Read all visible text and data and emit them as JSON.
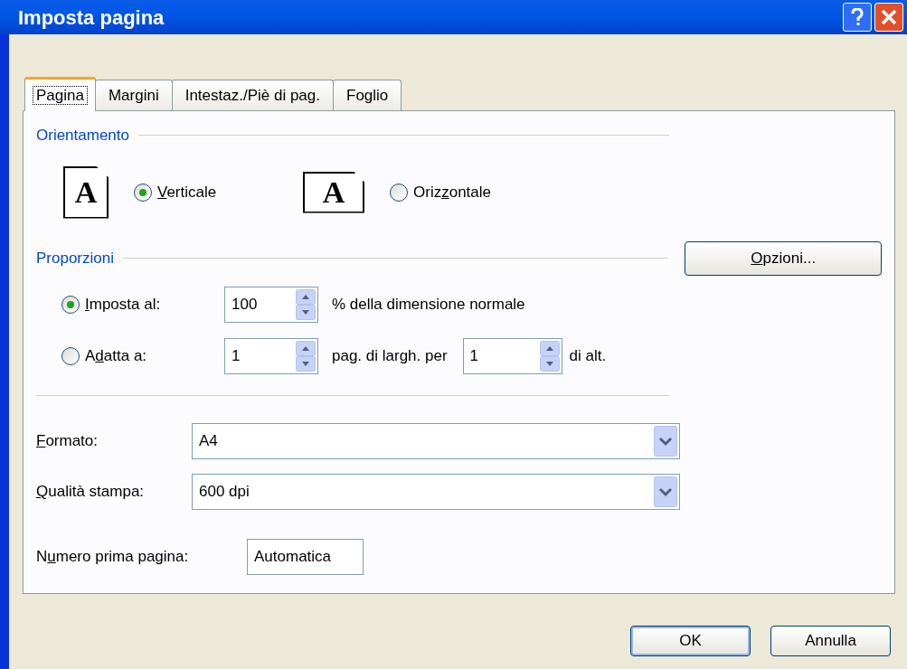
{
  "window": {
    "title": "Imposta pagina"
  },
  "tabs": [
    {
      "label": "Pagina",
      "selected": true
    },
    {
      "label": "Margini",
      "selected": false
    },
    {
      "label": "Intestaz./Piè di pag.",
      "selected": false
    },
    {
      "label": "Foglio",
      "selected": false
    }
  ],
  "orientation": {
    "title": "Orientamento",
    "options": [
      {
        "kind": "portrait",
        "glyph": "A",
        "label_key": "V",
        "label_post": "erticale",
        "selected": true
      },
      {
        "kind": "landscape",
        "glyph": "A",
        "label_pre": "Oriz",
        "label_key": "z",
        "label_post": "ontale",
        "selected": false
      }
    ]
  },
  "scaling": {
    "title": "Proporzioni",
    "options_button": {
      "label_key": "O",
      "label_post": "pzioni..."
    },
    "options": [
      {
        "label_key": "I",
        "label_post": "mposta al:",
        "selected": true,
        "value": "100",
        "suffix": "% della dimensione normale"
      },
      {
        "label_pre": "A",
        "label_key": "d",
        "label_post": "atta a:",
        "selected": false,
        "value": "1",
        "suffix": "pag. di largh. per",
        "value2": "1",
        "suffix2": "di alt."
      }
    ]
  },
  "fields": [
    {
      "kind": "dropdown",
      "label_key": "F",
      "label_post": "ormato:",
      "value": "A4"
    },
    {
      "kind": "dropdown",
      "label_key": "Q",
      "label_post": "ualità stampa:",
      "value": "600 dpi"
    },
    {
      "kind": "text",
      "label_pre": "N",
      "label_key": "u",
      "label_post": "mero prima pagina:",
      "value": "Automatica"
    }
  ],
  "buttons": [
    {
      "label": "OK",
      "default": true
    },
    {
      "label": "Annulla",
      "default": false
    }
  ]
}
